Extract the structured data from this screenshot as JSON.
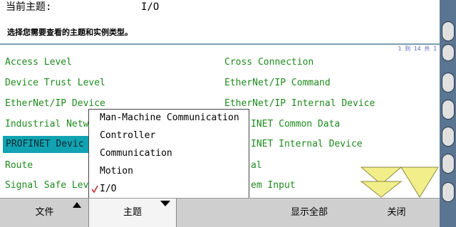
{
  "header": {
    "topic_label": "当前主题:",
    "topic_value": "I/O",
    "instruction": "选择您需要查看的主题和实例类型。"
  },
  "list": {
    "page_indicator": "1 到 14 共 1",
    "left_items": [
      "Access Level",
      "Device Trust Level",
      "EtherNet/IP Device",
      "Industrial Netw",
      "PROFINET Devic",
      "Route",
      "Signal Safe Lev"
    ],
    "right_items": [
      "Cross Connection",
      "EtherNet/IP Command",
      "EtherNet/IP Internal Device",
      "INET Common Data",
      "INET Internal Device",
      "al",
      "em Input"
    ],
    "selected_item": "PROFINET Devic"
  },
  "popup": {
    "items": [
      "Man-Machine Communication",
      "Controller",
      "Communication",
      "Motion",
      "I/O"
    ],
    "selected": "I/O"
  },
  "bottom_bar": {
    "file_label": "文件",
    "topic_label": "主题",
    "show_all_label": "显示全部",
    "close_label": "关闭"
  },
  "colors": {
    "item_text": "#1e8a1e",
    "selection_bg": "#11a3b2",
    "scroll_arrow_fill": "#f2ee8a",
    "bar_bg": "#cfcfcf"
  }
}
